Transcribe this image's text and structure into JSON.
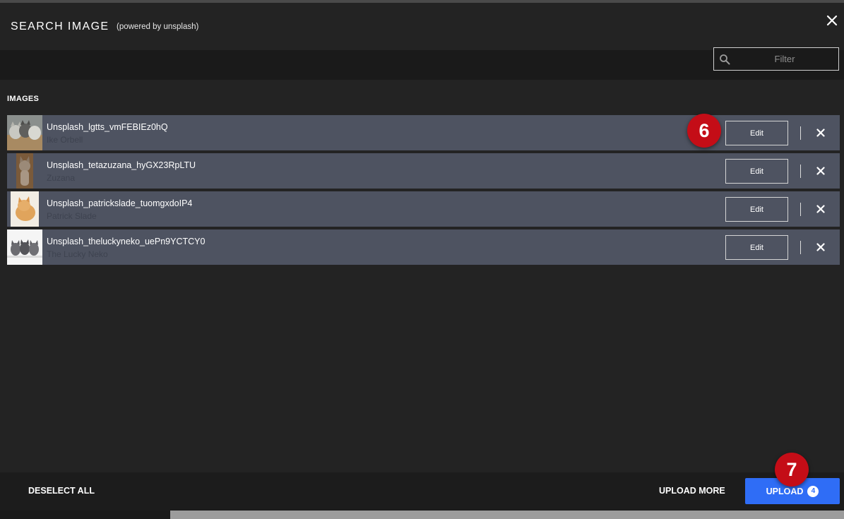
{
  "modal": {
    "title": "SEARCH IMAGE",
    "subtitle": "(powered by unsplash)",
    "close_icon": "close-icon"
  },
  "filter": {
    "placeholder": "Filter",
    "value": "",
    "icon": "search-icon"
  },
  "section": {
    "label": "IMAGES"
  },
  "images": [
    {
      "name": "Unsplash_lgtts_vmFEBIEz0hQ",
      "author": "Ike Orbell",
      "thumb": "kittens-in-basket",
      "edit_label": "Edit"
    },
    {
      "name": "Unsplash_tetazuzana_hyGX23RpLTU",
      "author": "Zuzana",
      "thumb": "tabby-kitten-standing",
      "edit_label": "Edit"
    },
    {
      "name": "Unsplash_patrickslade_tuomgxdoIP4",
      "author": "Patrick Slade",
      "thumb": "ginger-kitten",
      "edit_label": "Edit"
    },
    {
      "name": "Unsplash_theluckyneko_uePn9YCTCY0",
      "author": "The Lucky Neko",
      "thumb": "three-kittens",
      "edit_label": "Edit"
    }
  ],
  "footer": {
    "deselect_label": "DESELECT ALL",
    "upload_more_label": "UPLOAD MORE",
    "upload_label": "UPLOAD",
    "upload_count": "4"
  },
  "callouts": {
    "edit_step": "6",
    "upload_step": "7"
  },
  "colors": {
    "row_background": "#4e5361",
    "upload_button": "#2f6df6",
    "callout": "#c40d17",
    "modal_background": "#232323"
  }
}
